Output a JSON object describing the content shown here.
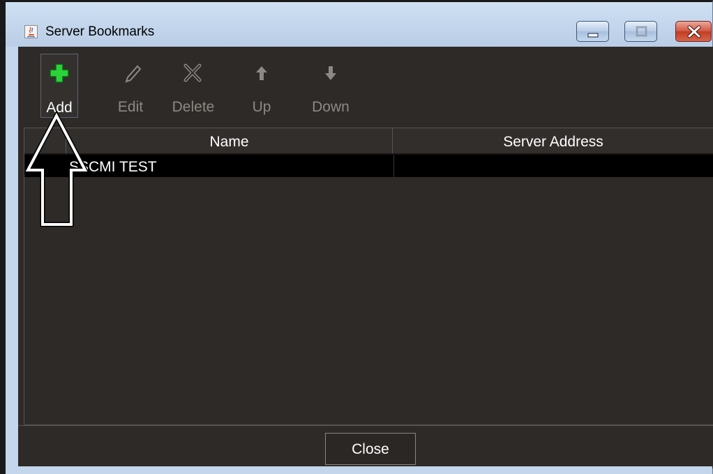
{
  "window": {
    "title": "Server Bookmarks",
    "icon": "java-cup-icon"
  },
  "titlebar_buttons": {
    "minimize": "minimize-icon",
    "maximize": "maximize-icon",
    "close": "close-icon"
  },
  "toolbar": {
    "items": [
      {
        "label": "Add",
        "icon": "plus-icon",
        "enabled": true
      },
      {
        "label": "Edit",
        "icon": "pencil-icon",
        "enabled": false
      },
      {
        "label": "Delete",
        "icon": "x-icon",
        "enabled": false
      },
      {
        "label": "Up",
        "icon": "arrow-up-icon",
        "enabled": false
      },
      {
        "label": "Down",
        "icon": "arrow-down-icon",
        "enabled": false
      }
    ]
  },
  "table": {
    "columns": [
      "",
      "Name",
      "Server Address"
    ],
    "rows": [
      {
        "index": "",
        "name": "SSCMI TEST",
        "address": ""
      }
    ]
  },
  "footer": {
    "close_label": "Close"
  },
  "colors": {
    "panel_bg": "#2e2a27",
    "selected_row": "#000000",
    "title_bar": "#c3d6ec",
    "add_icon": "#2bd33a",
    "disabled_text": "#8c8883",
    "close_button": "#c23c24"
  },
  "annotation": {
    "type": "callout-arrow",
    "icon": "arrow-up-outline-icon"
  }
}
